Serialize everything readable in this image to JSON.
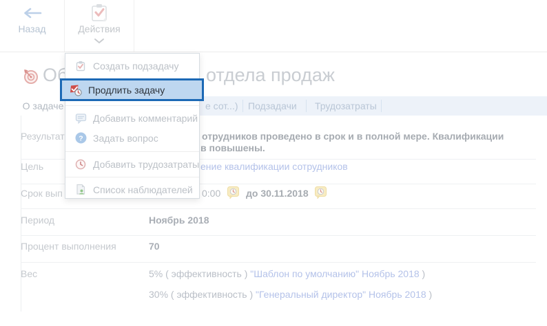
{
  "colors": {
    "accent_blue": "#1c69b5",
    "highlight_bg": "#bed7f0",
    "link_blue": "#b4c2e9",
    "tabbar_bg": "#edf2f9",
    "reminder_yellow": "#f8ecc3"
  },
  "toolbar": {
    "back_label": "Назад",
    "actions_label": "Действия"
  },
  "title": {
    "left_fragment": "Обуч",
    "right_fragment": "отдела продаж"
  },
  "tabs": [
    {
      "label": "О задаче",
      "active": true
    },
    {
      "label": "е сот...)",
      "active": false
    },
    {
      "label": "Подзадачи",
      "active": false
    },
    {
      "label": "Трудозатраты",
      "active": false
    }
  ],
  "menu": {
    "items": [
      {
        "label": "Создать подзадачу",
        "icon": "create-subtask-icon",
        "highlighted": false
      },
      {
        "label": "Продлить задачу",
        "icon": "extend-task-icon",
        "highlighted": true
      },
      {
        "label": "Добавить комментарий",
        "icon": "comment-icon",
        "highlighted": false
      },
      {
        "label": "Задать вопрос",
        "icon": "question-icon",
        "highlighted": false
      },
      {
        "label": "Добавить трудозатраты",
        "icon": "timelog-icon",
        "highlighted": false
      },
      {
        "label": "Список наблюдателей",
        "icon": "watchers-icon",
        "highlighted": false
      }
    ]
  },
  "fields": {
    "result": {
      "label": "Результат",
      "value_line1": "отрудников проведено в срок и в полной мере. Квалификации",
      "value_line2": "в повышены."
    },
    "goal": {
      "label": "Цель",
      "link_fragment": "ение квалификации сотрудников"
    },
    "deadline": {
      "label_fragment": "Срок вып",
      "time_fragment": "0:00",
      "until": "до 30.11.2018"
    },
    "period": {
      "label": "Период",
      "value": "Ноябрь 2018"
    },
    "percent": {
      "label": "Процент выполнения",
      "value": "70"
    },
    "weight": {
      "label": "Вес",
      "row1": {
        "prefix": "5% ( эффективность ) ",
        "link": "\"Шаблон по умолчанию\" Ноябрь 2018",
        "suffix": " )"
      },
      "row2": {
        "prefix": "30% ( эффективность ) ",
        "link": "\"Генеральный директор\" Ноябрь 2018",
        "suffix": " )"
      }
    }
  }
}
